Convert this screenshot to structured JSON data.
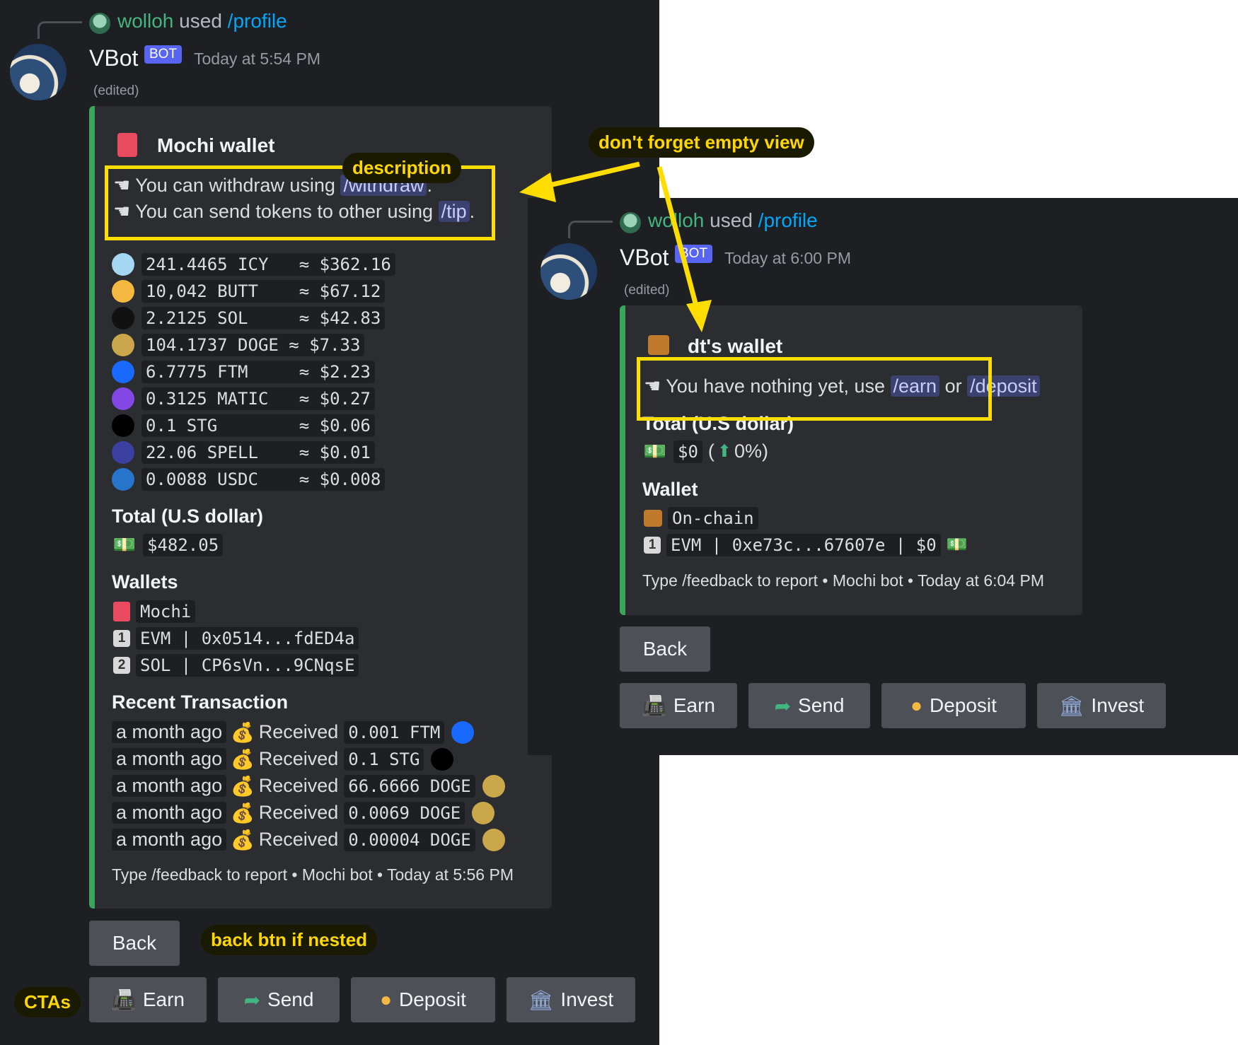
{
  "left": {
    "reply": {
      "user": "wolloh",
      "used": "used",
      "command": "/profile"
    },
    "bot": {
      "name": "VBot",
      "badge": "BOT",
      "timestamp": "Today at 5:54 PM",
      "edited": "(edited)"
    },
    "embed": {
      "title": "Mochi wallet",
      "desc_line1_pre": "You can withdraw using",
      "desc_line1_cmd": "/withdraw",
      "desc_line1_post": ".",
      "desc_line2_pre": "You can send tokens to other using",
      "desc_line2_cmd": "/tip",
      "desc_line2_post": ".",
      "tokens": [
        {
          "amount": "241.4465 ICY   ≈ $362.16",
          "icon": "ice-cube",
          "color": "#a5d8f3"
        },
        {
          "amount": "10,042 BUTT    ≈ $67.12",
          "icon": "butt-coin",
          "color": "#f5b942"
        },
        {
          "amount": "2.2125 SOL     ≈ $42.83",
          "icon": "solana",
          "color": "#111111"
        },
        {
          "amount": "104.1737 DOGE ≈ $7.33",
          "icon": "doge",
          "color": "#c9a74a"
        },
        {
          "amount": "6.7775 FTM     ≈ $2.23",
          "icon": "fantom",
          "color": "#1969ff"
        },
        {
          "amount": "0.3125 MATIC   ≈ $0.27",
          "icon": "polygon",
          "color": "#8247e5"
        },
        {
          "amount": "0.1 STG        ≈ $0.06",
          "icon": "stargate",
          "color": "#000000"
        },
        {
          "amount": "22.06 SPELL    ≈ $0.01",
          "icon": "spell",
          "color": "#3b3fa0"
        },
        {
          "amount": "0.0088 USDC    ≈ $0.008",
          "icon": "usdc",
          "color": "#2775ca"
        }
      ],
      "total_label": "Total (U.S dollar)",
      "total_value": "$482.05",
      "wallets_label": "Wallets",
      "wallets": [
        "Mochi",
        "EVM | 0x0514...fdED4a",
        "SOL | CP6sVn...9CNqsE"
      ],
      "wallet_keys": [
        "1",
        "2"
      ],
      "recent_label": "Recent Transaction",
      "transactions": [
        {
          "time": "a month ago",
          "action": "Received",
          "amount": "0.001 FTM",
          "coin": "fantom"
        },
        {
          "time": "a month ago",
          "action": "Received",
          "amount": "0.1 STG",
          "coin": "stargate"
        },
        {
          "time": "a month ago",
          "action": "Received",
          "amount": "66.6666 DOGE",
          "coin": "doge"
        },
        {
          "time": "a month ago",
          "action": "Received",
          "amount": "0.0069 DOGE",
          "coin": "doge"
        },
        {
          "time": "a month ago",
          "action": "Received",
          "amount": "0.00004 DOGE",
          "coin": "doge"
        }
      ],
      "footer": "Type /feedback to report • Mochi bot • Today at 5:56 PM"
    },
    "back": "Back",
    "ctas": [
      "Earn",
      "Send",
      "Deposit",
      "Invest"
    ]
  },
  "right": {
    "reply": {
      "user": "wolloh",
      "used": "used",
      "command": "/profile"
    },
    "bot": {
      "name": "VBot",
      "badge": "BOT",
      "timestamp": "Today at 6:00 PM",
      "edited": "(edited)"
    },
    "embed": {
      "title": "dt's wallet",
      "desc_pre": "You have nothing yet, use",
      "desc_cmd1": "/earn",
      "desc_or": "or",
      "desc_cmd2": "/deposit",
      "total_label": "Total (U.S dollar)",
      "total_value": "$0",
      "total_pct": "0%)",
      "total_paren": "(",
      "wallet_label": "Wallet",
      "wallets": [
        "On-chain",
        "EVM | 0xe73c...67607e | $0"
      ],
      "wallet_key": "1",
      "footer": "Type /feedback to report • Mochi bot • Today at 6:04 PM"
    },
    "back": "Back",
    "ctas": [
      "Earn",
      "Send",
      "Deposit",
      "Invest"
    ]
  },
  "annotations": {
    "description": "description",
    "empty_view": "don't forget empty view",
    "back_btn": "back btn if nested",
    "ctas": "CTAs"
  },
  "colors": {
    "highlight": "#ffdd00",
    "embed_bar": "#3ba55c",
    "bg": "#1e1f22",
    "embed_bg": "#2b2d31"
  }
}
